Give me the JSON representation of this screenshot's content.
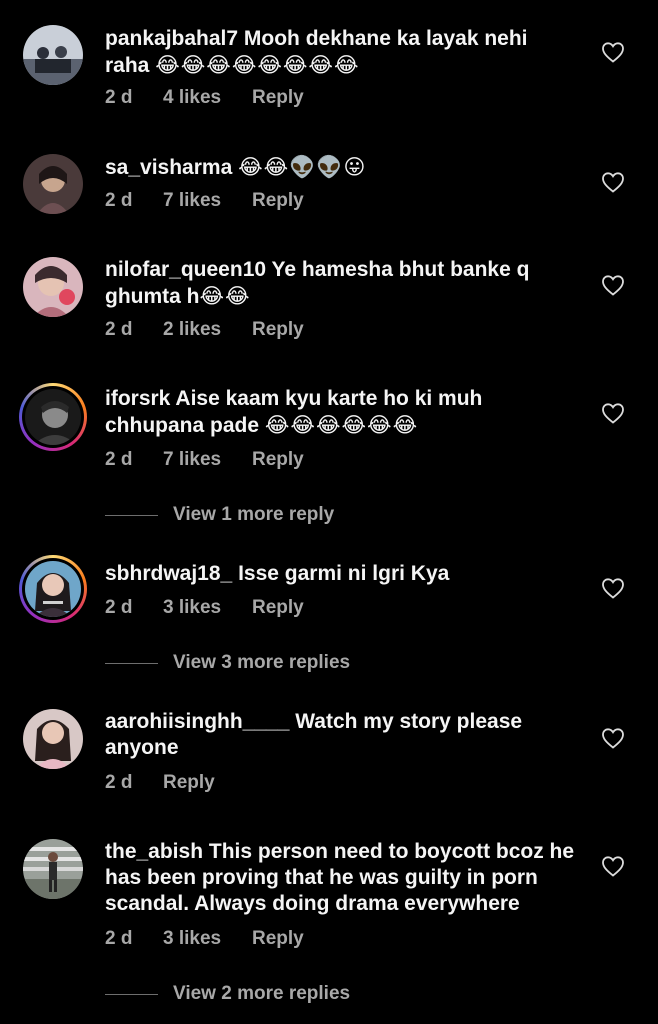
{
  "comments": [
    {
      "username": "pankajbahal7",
      "text": "Mooh dekhane ka layak nehi raha",
      "emojis": "😂😂😂😂😂😂😂😂",
      "time": "2 d",
      "likes": "4 likes",
      "reply": "Reply"
    },
    {
      "username": "sa_visharma",
      "text": "",
      "emojis": "😂😂👽👽😛",
      "time": "2 d",
      "likes": "7 likes",
      "reply": "Reply"
    },
    {
      "username": "nilofar_queen10",
      "text": "Ye hamesha bhut banke q ghumta h",
      "emojis": "😂😂",
      "time": "2 d",
      "likes": "2 likes",
      "reply": "Reply"
    },
    {
      "username": "iforsrk",
      "text": "Aise kaam kyu karte ho ki muh chhupana pade",
      "emojis": "😂😂😂😂😂😂",
      "time": "2 d",
      "likes": "7 likes",
      "reply": "Reply",
      "view_more": "View 1 more reply"
    },
    {
      "username": "sbhrdwaj18_",
      "text": "Isse garmi ni lgri Kya",
      "emojis": "",
      "time": "2 d",
      "likes": "3 likes",
      "reply": "Reply",
      "view_more": "View 3 more replies"
    },
    {
      "username": "aarohiisinghh____",
      "text": "Watch my story please anyone",
      "emojis": "",
      "time": "2 d",
      "likes": "",
      "reply": "Reply"
    },
    {
      "username": "the_abish",
      "text": "This person need to boycott bcoz he has been proving that he was guilty in porn scandal. Always doing drama everywhere",
      "emojis": "",
      "time": "2 d",
      "likes": "3 likes",
      "reply": "Reply",
      "view_more": "View 2 more replies"
    }
  ],
  "colors": {
    "background": "#000000",
    "text": "#f5f5f5",
    "muted": "#a8a8a8",
    "story_ring": [
      "#feda75",
      "#fa7e1e",
      "#d62976",
      "#962fbf",
      "#4f5bd5"
    ]
  },
  "icons": {
    "like": "heart-outline-icon"
  }
}
